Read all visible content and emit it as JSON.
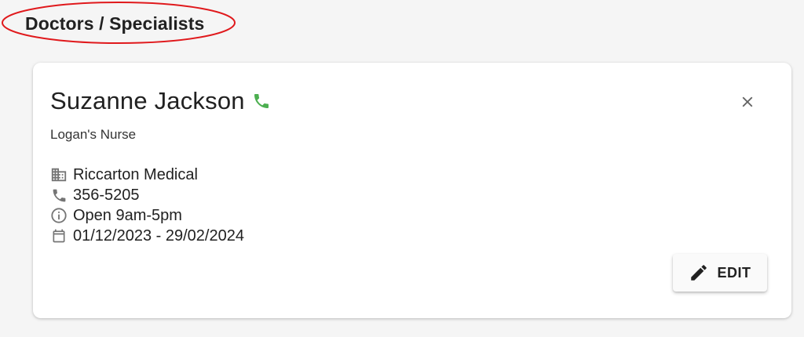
{
  "section": {
    "title": "Doctors / Specialists",
    "highlight_color": "#e0191c"
  },
  "contact": {
    "name": "Suzanne Jackson",
    "role": "Logan's Nurse",
    "phone_status_color": "#4caf50",
    "details": [
      {
        "icon": "building-icon",
        "text": "Riccarton Medical"
      },
      {
        "icon": "phone-icon",
        "text": "356-5205"
      },
      {
        "icon": "info-icon",
        "text": "Open 9am-5pm"
      },
      {
        "icon": "calendar-icon",
        "text": "01/12/2023 - 29/02/2024"
      }
    ]
  },
  "actions": {
    "edit_label": "EDIT",
    "close_icon": "close-icon"
  }
}
